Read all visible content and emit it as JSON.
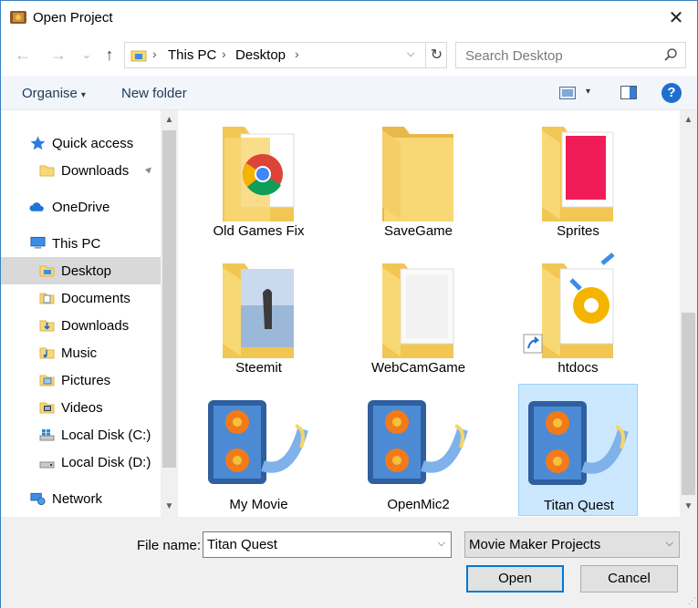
{
  "window": {
    "title": "Open Project",
    "close_glyph": "✕"
  },
  "nav": {
    "back_glyph": "←",
    "forward_glyph": "→",
    "recent_glyph": "⌄",
    "up_glyph": "↑"
  },
  "address": {
    "parts": [
      "This PC",
      "Desktop"
    ],
    "separator": "›",
    "dropdown_glyph": "⌵",
    "refresh_glyph": "↻"
  },
  "search": {
    "placeholder": "Search Desktop"
  },
  "toolbar": {
    "organise_label": "Organise",
    "caret_glyph": "▾",
    "new_folder_label": "New folder",
    "help_glyph": "?"
  },
  "sidebar": {
    "items": [
      {
        "label": "Quick access",
        "icon": "star-icon"
      },
      {
        "label": "Downloads",
        "icon": "folder-icon",
        "pinned": true
      },
      {
        "label": "OneDrive",
        "icon": "cloud-icon"
      },
      {
        "label": "This PC",
        "icon": "computer-icon"
      },
      {
        "label": "Desktop",
        "icon": "folder-icon",
        "selected": true
      },
      {
        "label": "Documents",
        "icon": "document-folder-icon"
      },
      {
        "label": "Downloads",
        "icon": "download-folder-icon"
      },
      {
        "label": "Music",
        "icon": "music-folder-icon"
      },
      {
        "label": "Pictures",
        "icon": "pictures-folder-icon"
      },
      {
        "label": "Videos",
        "icon": "videos-folder-icon"
      },
      {
        "label": "Local Disk (C:)",
        "icon": "windows-disk-icon"
      },
      {
        "label": "Local Disk (D:)",
        "icon": "disk-icon"
      },
      {
        "label": "Network",
        "icon": "network-icon"
      }
    ],
    "pin_glyph": "📌"
  },
  "scrollbar": {
    "up_glyph": "▲",
    "down_glyph": "▼"
  },
  "files": [
    {
      "name": "Old Games Fix",
      "type": "folder-chrome"
    },
    {
      "name": "SaveGame",
      "type": "folder-empty"
    },
    {
      "name": "Sprites",
      "type": "folder-pink"
    },
    {
      "name": "Steemit",
      "type": "folder-photo"
    },
    {
      "name": "WebCamGame",
      "type": "folder-document"
    },
    {
      "name": "htdocs",
      "type": "folder-shortcut"
    },
    {
      "name": "My Movie",
      "type": "movie-project"
    },
    {
      "name": "OpenMic2",
      "type": "movie-project"
    },
    {
      "name": "Titan Quest",
      "type": "movie-project",
      "selected": true
    }
  ],
  "bottom": {
    "file_name_label": "File name:",
    "file_name_value": "Titan Quest",
    "file_type_value": "Movie Maker Projects",
    "open_label": "Open",
    "cancel_label": "Cancel",
    "dropdown_glyph": "⌵"
  },
  "colors": {
    "accent": "#0078d7",
    "selection": "#cce8ff",
    "folder": "#f8d775",
    "toolbar_bg": "#f2f5fa"
  }
}
